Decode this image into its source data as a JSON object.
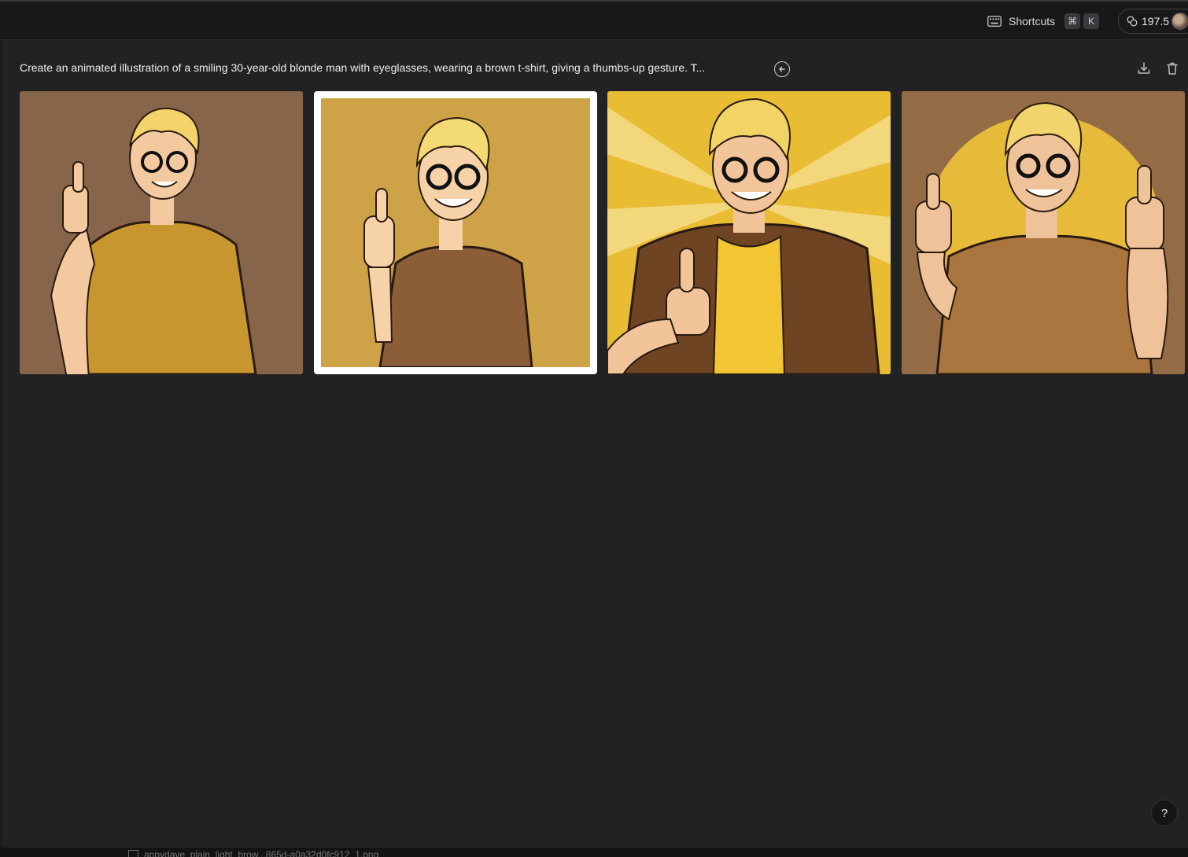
{
  "topbar": {
    "shortcuts_label": "Shortcuts",
    "shortcut_keys": [
      "⌘",
      "K"
    ],
    "credits": "197.5"
  },
  "prompt": {
    "text": "Create an animated illustration of a smiling 30-year-old blonde man with eyeglasses, wearing a brown t-shirt, giving a thumbs-up gesture. T..."
  },
  "images": [
    {
      "bg": "#86654a",
      "shirt": "#c8962e"
    },
    {
      "bg": "#cea247",
      "shirt": "#8b5e38"
    },
    {
      "bg": "#e8bd34",
      "shirt": "#6e4423"
    },
    {
      "bg": "#936c45",
      "shirt": "#a97640"
    }
  ],
  "help_label": "?",
  "taskbar": {
    "file_label": "appydave_plain_light_brow...865d-a0a32d0fc912_1.png"
  }
}
